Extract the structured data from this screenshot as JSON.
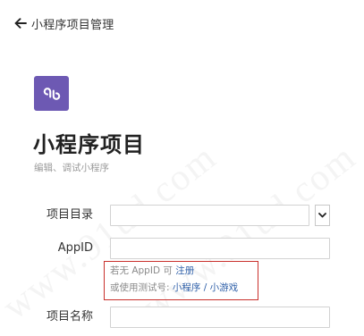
{
  "header": {
    "back_label": "小程序项目管理"
  },
  "project": {
    "title": "小程序项目",
    "subtitle": "编辑、调试小程序",
    "logo_color": "#6d59b3"
  },
  "form": {
    "directory_label": "项目目录",
    "directory_value": "",
    "appid_label": "AppID",
    "appid_value": "",
    "name_label": "项目名称",
    "name_value": ""
  },
  "hint": {
    "line1_prefix": "若无 AppID 可",
    "register_link": "注册",
    "line2_prefix": "或使用测试号:",
    "miniprogram_link": "小程序",
    "separator": " / ",
    "minigame_link": "小游戏"
  },
  "watermark": {
    "text": "www.91ud.com"
  },
  "colors": {
    "accent_link": "#2e5fa8",
    "hint_border": "#c9302c",
    "input_border": "#d2d2d2"
  },
  "icons": {
    "back": "arrow-left-icon",
    "logo": "mini-program-logo-icon",
    "dropdown": "chevron-down-icon"
  }
}
